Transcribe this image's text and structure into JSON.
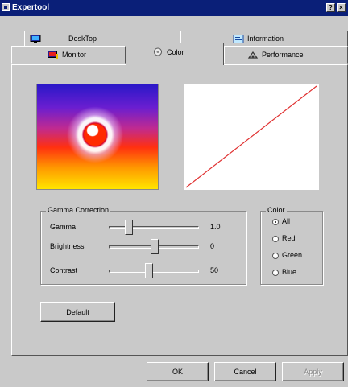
{
  "window": {
    "title": "Expertool",
    "help_glyph": "?",
    "close_glyph": "×"
  },
  "tabs": {
    "back_row": [
      {
        "label": "DeskTop",
        "icon": "monitor-icon"
      },
      {
        "label": "Information",
        "icon": "info-icon"
      }
    ],
    "front_row": [
      {
        "label": "Monitor",
        "icon": "monitor-adjust-icon"
      },
      {
        "label": "Color",
        "icon": "color-wheel-icon"
      },
      {
        "label": "Performance",
        "icon": "performance-icon"
      }
    ],
    "selected": "Color"
  },
  "gamma_group": {
    "title": "Gamma Correction",
    "gamma": {
      "label": "Gamma",
      "value": "1.0"
    },
    "brightness": {
      "label": "Brightness",
      "value": "0"
    },
    "contrast": {
      "label": "Contrast",
      "value": "50"
    }
  },
  "color_group": {
    "title": "Color",
    "options": [
      "All",
      "Red",
      "Green",
      "Blue"
    ],
    "selected": "All"
  },
  "buttons": {
    "default": "Default",
    "ok": "OK",
    "cancel": "Cancel",
    "apply": "Apply"
  },
  "curve": {
    "line_color": "#e03030"
  }
}
